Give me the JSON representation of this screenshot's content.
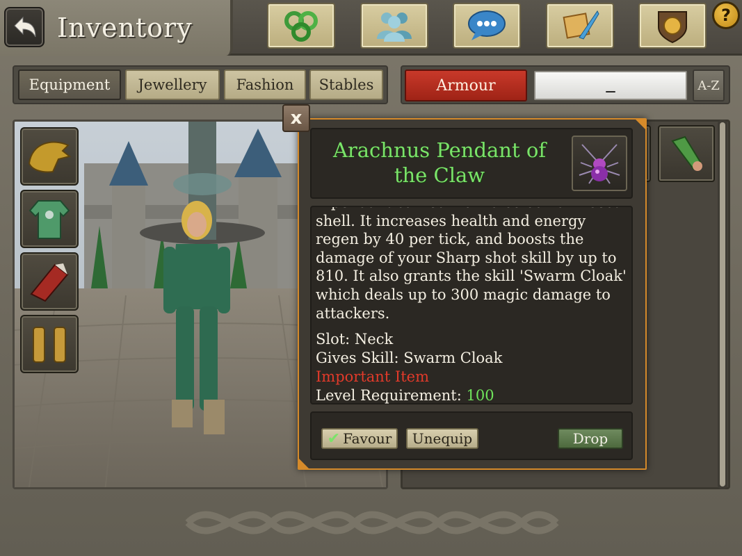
{
  "header": {
    "title": "Inventory",
    "back_icon": "back-arrow-icon",
    "nav_icons": [
      "skills-triskele-icon",
      "social-friends-icon",
      "chat-bubble-icon",
      "quest-scroll-icon",
      "guild-crest-icon"
    ],
    "help_label": "?"
  },
  "tabs": [
    {
      "label": "Equipment",
      "active": true
    },
    {
      "label": "Jewellery",
      "active": false
    },
    {
      "label": "Fashion",
      "active": false
    },
    {
      "label": "Stables",
      "active": false
    }
  ],
  "filter": {
    "category_label": "Armour",
    "search_value": "_",
    "sort_label": "A-Z"
  },
  "equip_slots": [
    "dragon-helm-icon",
    "green-tunic-icon",
    "red-shield-icon",
    "leg-greaves-icon"
  ],
  "popup": {
    "close_label": "x",
    "item_name": "Arachnus Pendant of the Claw",
    "item_icon": "spider-pendant-icon",
    "description": "A pendant carved from a colourful insect shell. It increases health and energy regen by 40 per tick, and boosts the damage of your Sharp shot skill by up to 810. It also grants the skill 'Swarm Cloak' which deals up to 300 magic damage to attackers.",
    "slot_line": "Slot: Neck",
    "skill_line": "Gives Skill: Swarm Cloak",
    "important_line": "Important Item",
    "level_label": "Level Requirement:",
    "level_value": "100",
    "favour_label": "Favour",
    "unequip_label": "Unequip",
    "drop_label": "Drop"
  },
  "colors": {
    "item_name": "#7be36a",
    "important": "#e23a2a",
    "level_value": "#6fe45b",
    "armour_button": "#c8392a",
    "popup_border": "#d58a2a"
  }
}
